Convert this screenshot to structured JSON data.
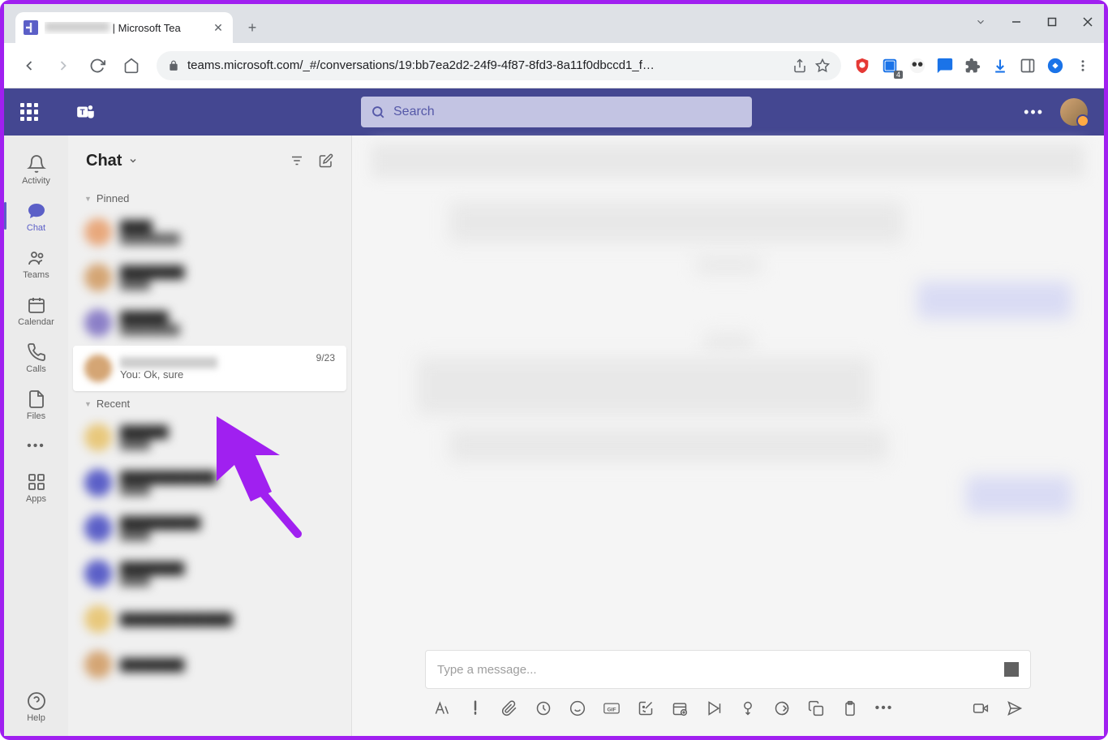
{
  "browser": {
    "tab_title": "| Microsoft Tea",
    "url": "teams.microsoft.com/_#/conversations/19:bb7ea2d2-24f9-4f87-8fd3-8a11f0dbccd1_f…",
    "ext_badge": "4"
  },
  "header": {
    "search_placeholder": "Search"
  },
  "rail": {
    "activity": "Activity",
    "chat": "Chat",
    "teams": "Teams",
    "calendar": "Calendar",
    "calls": "Calls",
    "files": "Files",
    "apps": "Apps",
    "help": "Help"
  },
  "chatlist": {
    "title": "Chat",
    "pinned_label": "Pinned",
    "recent_label": "Recent",
    "selected": {
      "date": "9/23",
      "preview": "You: Ok, sure"
    }
  },
  "compose": {
    "placeholder": "Type a message..."
  }
}
